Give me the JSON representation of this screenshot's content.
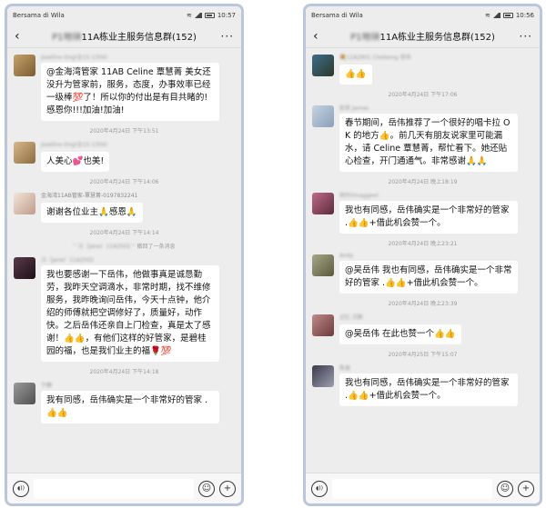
{
  "left": {
    "status": {
      "carrier": "Bersama di Wila",
      "time": "10:57"
    },
    "header": {
      "title_prefix": "P1地块",
      "title": "11A栋业主服务信息群(152)"
    },
    "messages": [
      {
        "kind": "msg",
        "avatar_class": "av-1",
        "sender": "Joseline Ong(全15-1304)",
        "text": "@金海湾管家 11AB Celine 覃慧菁 美女还没升为管家前，服务，态度，办事效率已经一级棒💯了！所以你的付出是有目共睹的!感恩你!!!加油!加油!"
      },
      {
        "kind": "time",
        "text": "2020年4月24日 下午13:51"
      },
      {
        "kind": "msg",
        "avatar_class": "av-2",
        "sender": "Joseline Ong(全15-1304)",
        "text": "人美心💕也美!"
      },
      {
        "kind": "time",
        "text": "2020年4月24日 下午14:06"
      },
      {
        "kind": "msg",
        "avatar_class": "av-3",
        "sender": "金海湾11AB管家-覃慧菁-0197832241",
        "sender_clear": true,
        "text": "谢谢各位业主🙏感恩🙏"
      },
      {
        "kind": "time",
        "text": "2020年4月24日 下午14:14"
      },
      {
        "kind": "notice",
        "blur": "“ 汪（Jane）11A2502 ”",
        "text": "撤回了一条消息"
      },
      {
        "kind": "msg",
        "avatar_class": "av-4",
        "sender": "汪（Jane）11A2502",
        "text": "我也要感谢一下岳伟，他做事真是诚恳勤劳，我昨天空调滴水，非常时期，找不维修服务，我昨晚询问岳伟，今天十点钟，他介绍的师傅就把空调修好了，质量好，动作快。之后岳伟还亲自上门检查，真是太了感谢！👍👍，有他们这样的好管家，是碧桂园的福，也是我们业主的福🌹💯"
      },
      {
        "kind": "time",
        "text": "2020年4月24日 下午14:18"
      },
      {
        "kind": "msg",
        "avatar_class": "av-5",
        "sender": "宁静",
        "text": "我有同感，岳伟确实是一个非常好的管家 .👍👍"
      }
    ]
  },
  "right": {
    "status": {
      "carrier": "Bersama di Wila",
      "time": "10:56"
    },
    "header": {
      "title_prefix": "P1地块",
      "title": "11A栋业主服务信息群(152)"
    },
    "messages": [
      {
        "kind": "msg",
        "avatar_class": "av-6",
        "sender": "💐11A2901 Cheleong 张伟",
        "text": "👍👍"
      },
      {
        "kind": "time",
        "text": "2020年4月24日 下午17:06"
      },
      {
        "kind": "msg",
        "avatar_class": "av-7",
        "sender": "彭英 James",
        "text": "春节期间，岳伟推荐了一个很好的唱卡拉 OK 的地方👍。前几天有朋友说家里可能漏水，请 Celine 覃慧菁，帮忙看下。她还贴心检查，开门通通气。非常感谢🙏🙏"
      },
      {
        "kind": "time",
        "text": "2020年4月24日 晚上18:19"
      },
      {
        "kind": "msg",
        "avatar_class": "av-8",
        "sender": "明丹(Imaggee)",
        "text": "我也有同感，岳伟确实是一个非常好的管家 .👍👍+借此机会赞一个。"
      },
      {
        "kind": "time",
        "text": "2020年4月24日 晚上23:21"
      },
      {
        "kind": "msg",
        "avatar_class": "av-9",
        "sender": "Andy",
        "text": "@吴岳伟  我也有同感，岳伟确实是一个非常好的管家 .👍👍+借此机会赞一个。"
      },
      {
        "kind": "time",
        "text": "2020年4月24日 晚上23:39"
      },
      {
        "kind": "msg",
        "avatar_class": "av-10",
        "sender": "记忆 沉默",
        "text": "@吴岳伟  在此也赞一个👍👍"
      },
      {
        "kind": "time",
        "text": "2020年4月25日 下午15:07"
      },
      {
        "kind": "msg",
        "avatar_class": "av-11",
        "sender": "陈美",
        "text": "我也有同感，岳伟确实是一个非常好的管家 .👍👍+借此机会赞一个。"
      }
    ]
  },
  "inputbar": {
    "voice_glyph": "◖))",
    "emoji_glyph": "☺",
    "plus_glyph": "+"
  }
}
